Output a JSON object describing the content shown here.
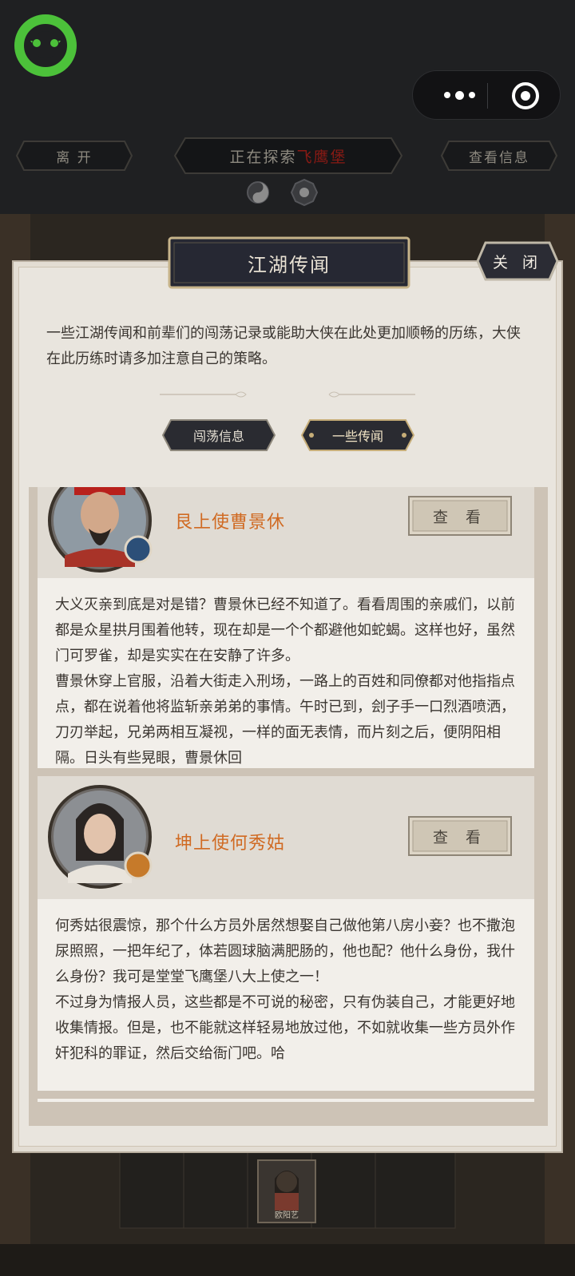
{
  "nav": {
    "leave_label": "离 开",
    "status_prefix": "正在探索",
    "status_place": "飞鹰堡",
    "info_label": "查看信息"
  },
  "panel": {
    "title": "江湖传闻",
    "close_label": "关 闭",
    "intro": "一些江湖传闻和前辈们的闯荡记录或能助大侠在此处更加顺畅的历练，大侠在此历练时请多加注意自己的策略。",
    "tabs": [
      {
        "label": "闯荡信息",
        "active": false
      },
      {
        "label": "一些传闻",
        "active": true
      }
    ]
  },
  "cards": [
    {
      "name": "艮上使曹景休",
      "view_label": "查 看",
      "text": "大义灭亲到底是对是错？曹景休已经不知道了。看看周围的亲戚们，以前都是众星拱月围着他转，现在却是一个个都避他如蛇蝎。这样也好，虽然门可罗雀，却是实实在在安静了许多。\n曹景休穿上官服，沿着大街走入刑场，一路上的百姓和同僚都对他指指点点，都在说着他将监斩亲弟弟的事情。午时已到，刽子手一口烈酒喷洒，刀刃举起，兄弟两相互凝视，一样的面无表情，而片刻之后，便阴阳相隔。日头有些晃眼，曹景休回"
    },
    {
      "name": "坤上使何秀姑",
      "view_label": "查 看",
      "text": "何秀姑很震惊，那个什么方员外居然想娶自己做他第八房小妾？也不撒泡尿照照，一把年纪了，体若圆球脑满肥肠的，他也配？他什么身份，我什么身份？我可是堂堂飞鹰堡八大上使之一！\n不过身为情报人员，这些都是不可说的秘密，只有伪装自己，才能更好地收集情报。但是，也不能就这样轻易地放过他，不如就收集一些方员外作奸犯科的罪证，然后交给衙门吧。哈"
    }
  ],
  "map": {
    "thumb_name": "欧阳艺"
  },
  "colors": {
    "accent_name": "#d06a22",
    "place_red": "#8a1a14",
    "logo_green": "#4cc13a"
  }
}
